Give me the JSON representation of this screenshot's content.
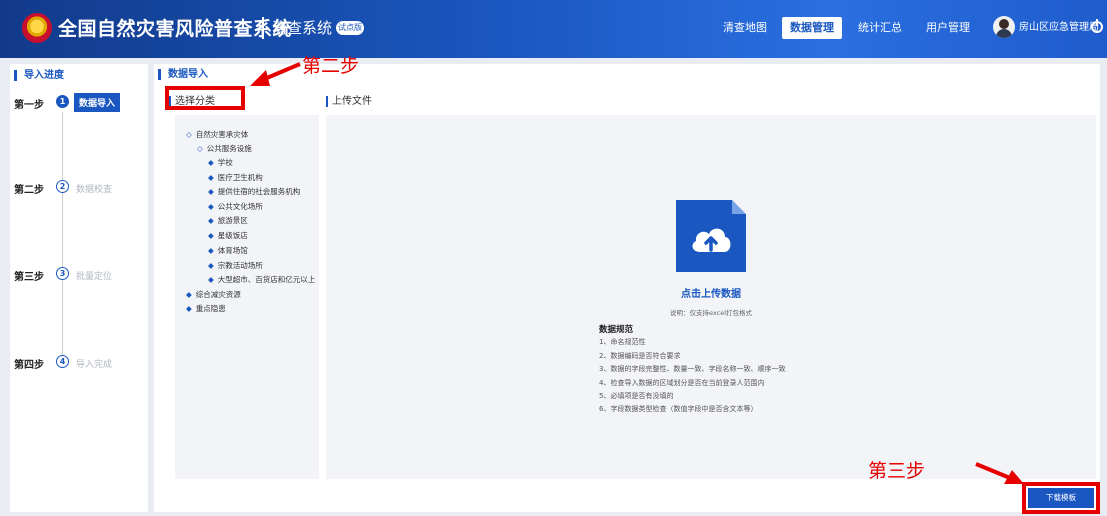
{
  "header": {
    "title": "全国自然灾害风险普查系统",
    "subtitle": "清查系统",
    "badge": "试点版",
    "nav": [
      "清查地图",
      "数据管理",
      "统计汇总",
      "用户管理"
    ],
    "active_nav": "数据管理",
    "user": "房山区应急管理局"
  },
  "left_panel": {
    "title": "导入进度",
    "steps": [
      {
        "label": "第一步",
        "num": "1",
        "name": "数据导入",
        "state": "active"
      },
      {
        "label": "第二步",
        "num": "2",
        "name": "数据校查",
        "state": "todo"
      },
      {
        "label": "第三步",
        "num": "3",
        "name": "批量定位",
        "state": "todo"
      },
      {
        "label": "第四步",
        "num": "4",
        "name": "导入完成",
        "state": "todo"
      }
    ]
  },
  "main": {
    "title": "数据导入",
    "category_title": "选择分类",
    "upload_title": "上传文件",
    "tree": [
      {
        "icon": "◇",
        "label": "自然灾害承灾体"
      },
      {
        "icon": "◇",
        "label": "公共服务设施"
      },
      {
        "icon": "◆",
        "label": "学校"
      },
      {
        "icon": "◆",
        "label": "医疗卫生机构"
      },
      {
        "icon": "◆",
        "label": "提供住宿的社会服务机构"
      },
      {
        "icon": "◆",
        "label": "公共文化场所"
      },
      {
        "icon": "◆",
        "label": "旅游景区"
      },
      {
        "icon": "◆",
        "label": "星级饭店"
      },
      {
        "icon": "◆",
        "label": "体育场馆"
      },
      {
        "icon": "◆",
        "label": "宗教活动场所"
      },
      {
        "icon": "◆",
        "label": "大型超市、百货店和亿元以上"
      },
      {
        "icon": "◆",
        "label": "综合减灾资源"
      },
      {
        "icon": "◆",
        "label": "重点隐患"
      }
    ],
    "upload": {
      "icon": "cloud-upload-icon",
      "action": "点击上传数据",
      "note": "说明：仅支持excel打包格式"
    },
    "spec": {
      "title": "数据规范",
      "items": [
        "1、命名规范性",
        "2、数据编码是否符合要求",
        "3、数据的字段完整性、数量一致、字段名称一致、顺序一致",
        "4、检查导入数据的区域划分是否在当前登录人范围内",
        "5、必填项是否有没填的",
        "6、字段数据类型检查（数值字段中是否含文本等）"
      ]
    },
    "download_label": "下载模板"
  },
  "annotations": {
    "step2": "第二步",
    "step3": "第三步",
    "color": "#e60000"
  }
}
